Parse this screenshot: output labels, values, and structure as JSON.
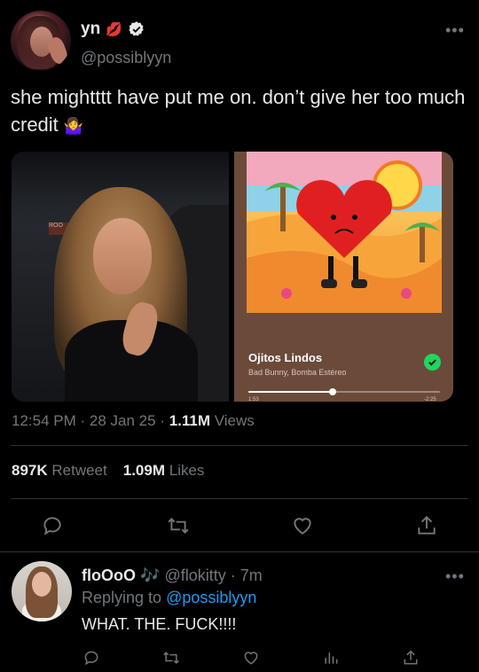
{
  "tweet": {
    "author": {
      "display_name": "yn",
      "name_emoji": "lips-icon",
      "handle": "@possiblyyn",
      "verified": true
    },
    "more_label": "•••",
    "text": "she mightttt have put me on. don’t give her too much credit",
    "text_emoji": "🤷‍♀️",
    "media": {
      "song": {
        "title": "Ojitos Lindos",
        "artist": "Bad Bunny, Bomba Estéreo",
        "elapsed": "1:53",
        "remaining": "-2:25",
        "progress_fraction": 0.44,
        "saved": true
      },
      "photo_sign_text": "ROO"
    },
    "time": "12:54 PM",
    "date": "28 Jan 25",
    "views_count": "1.11M",
    "views_label": "Views",
    "retweet_count": "897K",
    "retweet_label": "Retweet",
    "likes_count": "1.09M",
    "likes_label": "Likes",
    "actions": [
      "reply-icon",
      "retweet-icon",
      "like-icon",
      "share-icon"
    ]
  },
  "reply": {
    "display_name": "floOoO",
    "name_emoji": "🎶",
    "handle": "@flokitty",
    "age": "7m",
    "replying_prefix": "Replying to",
    "replying_to": "@possiblyyn",
    "text": "WHAT. THE. FUCK!!!!",
    "more_label": "•••",
    "actions": [
      "reply-icon",
      "retweet-icon",
      "like-icon",
      "views-icon",
      "share-icon"
    ]
  },
  "colors": {
    "background": "#000000",
    "text": "#e7e9ea",
    "muted": "#71767b",
    "link": "#1d9bf0",
    "verified": "#1d9bf0",
    "spotify_green": "#1ed760"
  }
}
